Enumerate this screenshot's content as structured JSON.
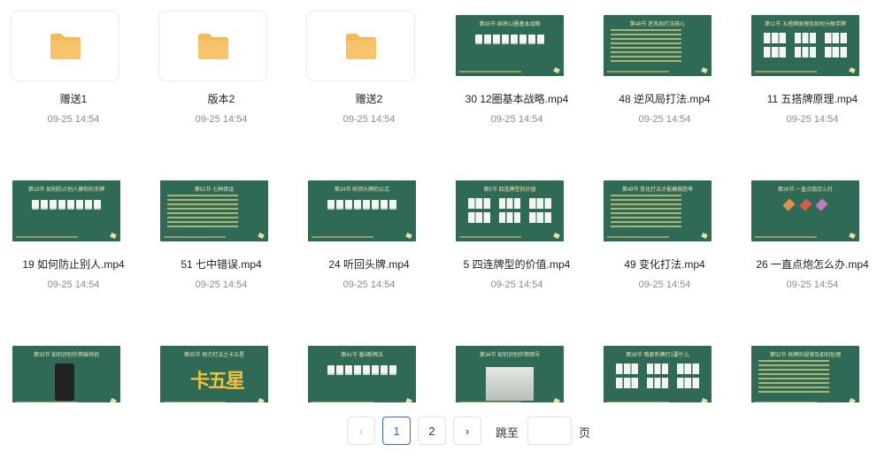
{
  "files": [
    {
      "name": "赠送1",
      "time": "09-25 14:54",
      "kind": "folder"
    },
    {
      "name": "版本2",
      "time": "09-25 14:54",
      "kind": "folder"
    },
    {
      "name": "赠送2",
      "time": "09-25 14:54",
      "kind": "folder"
    },
    {
      "name": "30 12圈基本战略.mp4",
      "time": "09-25 14:54",
      "kind": "video",
      "thumb_title": "第30节  麻将12圈基本战略",
      "style": "tiles"
    },
    {
      "name": "48 逆风局打法.mp4",
      "time": "09-25 14:54",
      "kind": "video",
      "thumb_title": "第48节  逆风局打法核心",
      "style": "lines"
    },
    {
      "name": "11 五搭牌原理.mp4",
      "time": "09-25 14:54",
      "kind": "video",
      "thumb_title": "第11节  五搭牌原理及如何分解手牌",
      "style": "grid"
    },
    {
      "name": "19 如何防止别人.mp4",
      "time": "09-25 14:54",
      "kind": "video",
      "thumb_title": "第19节  如何防止别人摸你的手牌",
      "style": "tiles"
    },
    {
      "name": "51 七中错误.mp4",
      "time": "09-25 14:54",
      "kind": "video",
      "thumb_title": "第51节  七种错误",
      "style": "lines"
    },
    {
      "name": "24 听回头牌.mp4",
      "time": "09-25 14:54",
      "kind": "video",
      "thumb_title": "第24节  听回头牌的公式",
      "style": "tiles"
    },
    {
      "name": "5 四连牌型的价值.mp4",
      "time": "09-25 14:54",
      "kind": "video",
      "thumb_title": "第5节  四连牌型的价值",
      "style": "grid"
    },
    {
      "name": "49 变化打法.mp4",
      "time": "09-25 14:54",
      "kind": "video",
      "thumb_title": "第49节  变化打法才能确保胜率",
      "style": "lines"
    },
    {
      "name": "26 一直点炮怎么办.mp4",
      "time": "09-25 14:54",
      "kind": "video",
      "thumb_title": "第26节  一直点炮怎么打",
      "style": "dice"
    },
    {
      "name": "",
      "time": "",
      "kind": "video",
      "thumb_title": "第33节  如何识别作弊麻将机",
      "style": "phone"
    },
    {
      "name": "",
      "time": "",
      "kind": "video",
      "thumb_title": "第05节  地方打法之卡五星",
      "style": "big"
    },
    {
      "name": "",
      "time": "",
      "kind": "video",
      "thumb_title": "第41节  番5断牌法",
      "style": "tiles"
    },
    {
      "name": "",
      "time": "",
      "kind": "video",
      "thumb_title": "第34节  如何识别作弊暗号",
      "style": "photo"
    },
    {
      "name": "",
      "time": "",
      "kind": "video",
      "thumb_title": "第38节  哦家听牌打1要什么",
      "style": "grid"
    },
    {
      "name": "",
      "time": "",
      "kind": "video",
      "thumb_title": "第52节  抢牌的规律及如何处理",
      "style": "lines"
    }
  ],
  "big_text": "卡五星",
  "pagination": {
    "prev_icon": "‹",
    "next_icon": "›",
    "pages": [
      "1",
      "2"
    ],
    "current": "1",
    "jump_label": "跳至",
    "page_unit": "页",
    "jump_value": ""
  },
  "colors": {
    "accent": "#2d6be0",
    "thumb_bg": "#2e6a56",
    "folder": "#f7c46b"
  }
}
